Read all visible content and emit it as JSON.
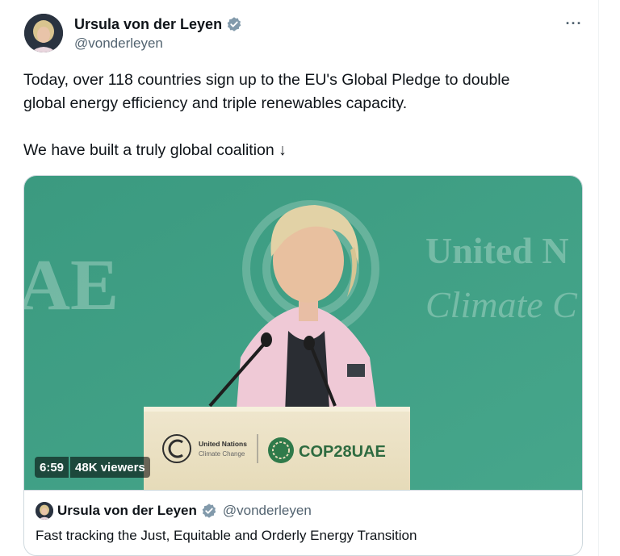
{
  "author": {
    "name": "Ursula von der Leyen",
    "handle": "@vonderleyen"
  },
  "more_label": "···",
  "tweet": {
    "line1": "Today, over 118 countries sign up to the EU's Global Pledge to double",
    "line2": "global energy efficiency and triple renewables capacity.",
    "line3": "We have built a truly global coalition ↓"
  },
  "video": {
    "duration": "6:59",
    "views": "48K viewers",
    "backdrop_text_left": "AE",
    "backdrop_text_right1": "United N",
    "backdrop_text_right2": "Climate C",
    "podium_un_line1": "United Nations",
    "podium_un_line2": "Climate Change",
    "podium_cop": "COP28UAE"
  },
  "quote": {
    "name": "Ursula von der Leyen",
    "handle": "@vonderleyen",
    "title": "Fast tracking the Just, Equitable and Orderly Energy Transition"
  },
  "colors": {
    "backdrop": "#3f9e84",
    "verified": "#829aab",
    "jacket": "#efc9d6"
  }
}
